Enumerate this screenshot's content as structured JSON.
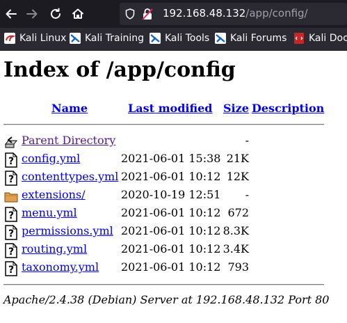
{
  "browser": {
    "url_host": "192.168.48.132",
    "url_path": "/app/config/",
    "bookmarks": [
      {
        "label": "Kali Linux",
        "icon": "kali-dragon-icon"
      },
      {
        "label": "Kali Training",
        "icon": "kali-training-icon"
      },
      {
        "label": "Kali Tools",
        "icon": "kali-tools-icon"
      },
      {
        "label": "Kali Forums",
        "icon": "kali-forums-icon"
      },
      {
        "label": "Kali Docs",
        "icon": "kali-docs-icon"
      }
    ]
  },
  "page": {
    "title": "Index of /app/config",
    "columns": {
      "name": "Name",
      "last_modified": "Last modified",
      "size": "Size",
      "description": "Description"
    },
    "rows": [
      {
        "icon": "back-folder-icon",
        "name": "Parent Directory",
        "date": "",
        "size": "-"
      },
      {
        "icon": "unknown-file-icon",
        "name": "config.yml",
        "date": "2021-06-01 15:38",
        "size": "21K"
      },
      {
        "icon": "unknown-file-icon",
        "name": "contenttypes.yml",
        "date": "2021-06-01 10:12",
        "size": "12K"
      },
      {
        "icon": "folder-icon",
        "name": "extensions/",
        "date": "2020-10-19 12:51",
        "size": "-"
      },
      {
        "icon": "unknown-file-icon",
        "name": "menu.yml",
        "date": "2021-06-01 10:12",
        "size": "672"
      },
      {
        "icon": "unknown-file-icon",
        "name": "permissions.yml",
        "date": "2021-06-01 10:12",
        "size": "8.3K"
      },
      {
        "icon": "unknown-file-icon",
        "name": "routing.yml",
        "date": "2021-06-01 10:12",
        "size": "3.4K"
      },
      {
        "icon": "unknown-file-icon",
        "name": "taxonomy.yml",
        "date": "2021-06-01 10:12",
        "size": "793"
      }
    ],
    "address": "Apache/2.4.38 (Debian) Server at 192.168.48.132 Port 80"
  },
  "colors": {
    "link": "#0000ee",
    "visited": "#551a8b",
    "toolbar_bg": "#1c1b22",
    "bookmarks_bg": "#2b2a33"
  }
}
